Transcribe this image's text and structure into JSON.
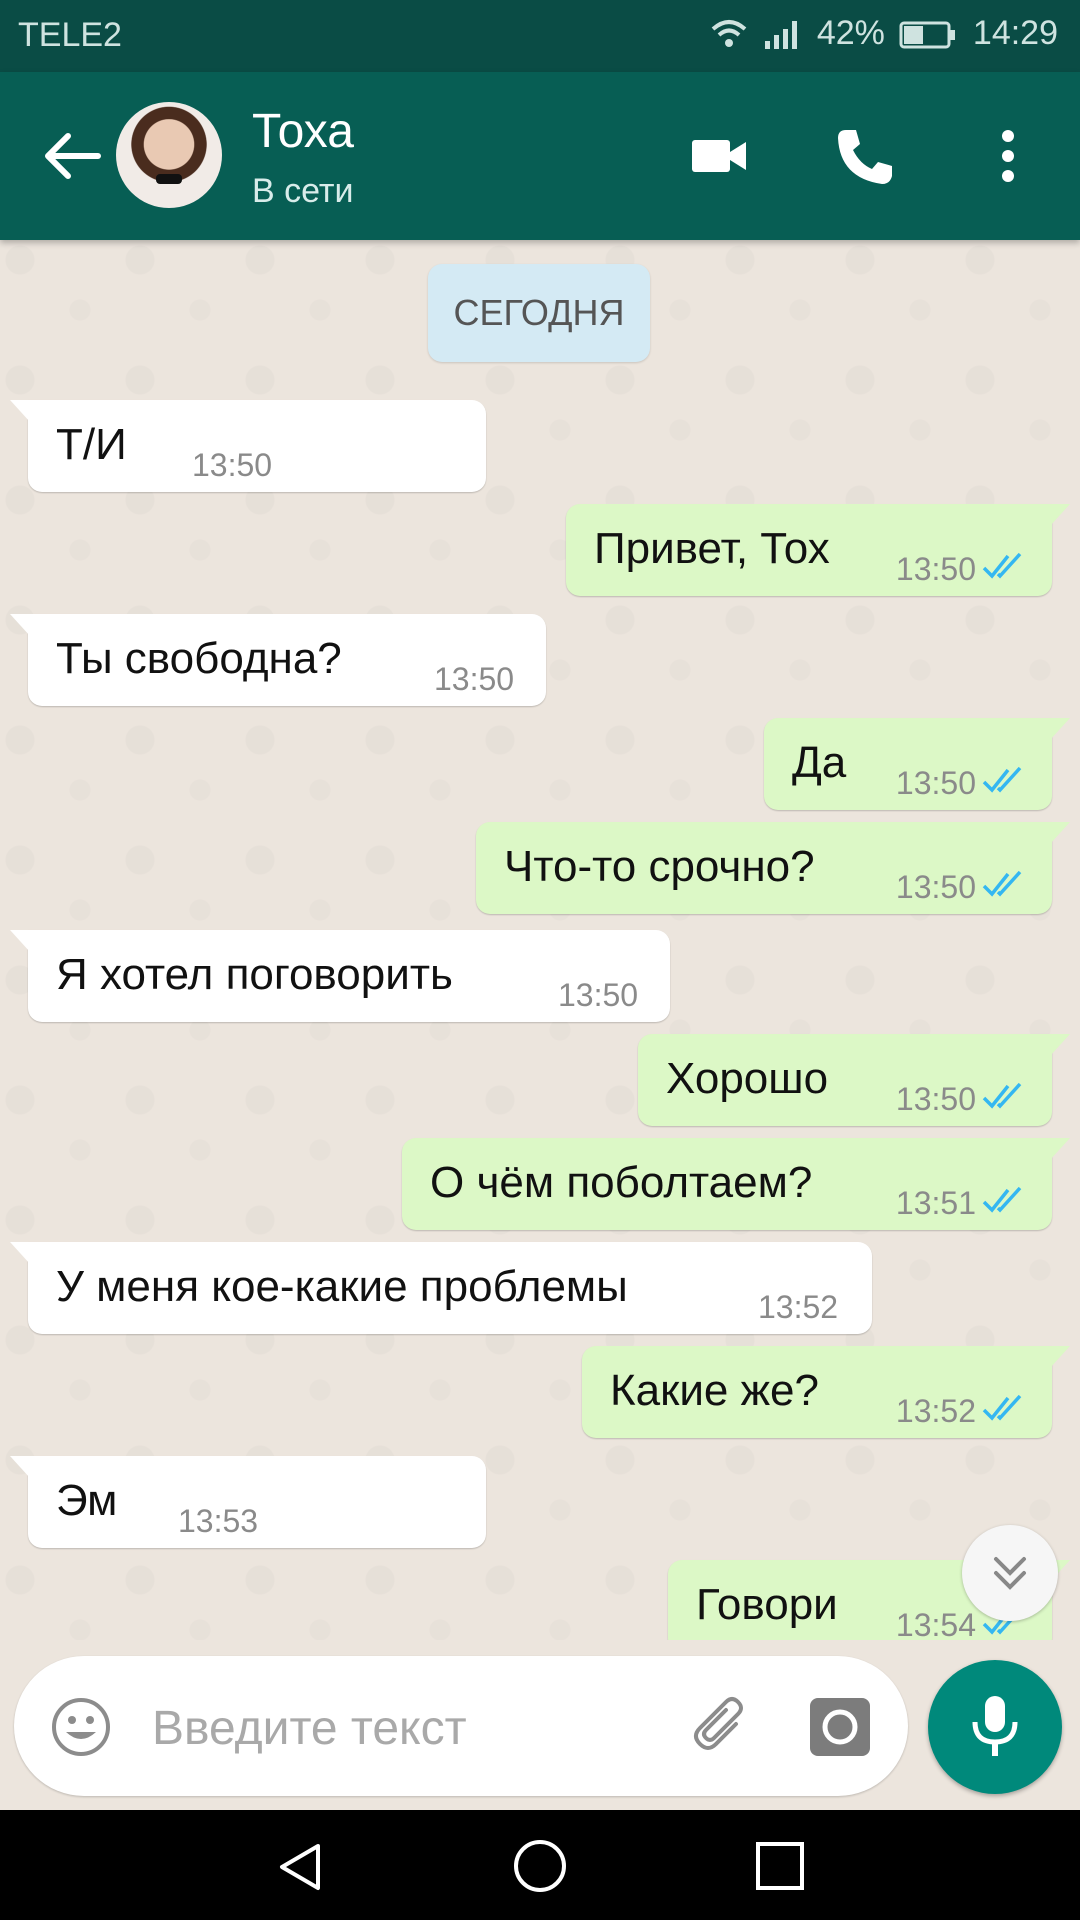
{
  "status_bar": {
    "carrier": "TELE2",
    "battery": "42%",
    "time": "14:29"
  },
  "header": {
    "name": "Тоха",
    "status": "В сети"
  },
  "date_chip": "СЕГОДНЯ",
  "messages": [
    {
      "dir": "in",
      "text": "Т/И",
      "time": "13:50"
    },
    {
      "dir": "out",
      "text": "Привет, Тох",
      "time": "13:50"
    },
    {
      "dir": "in",
      "text": "Ты свободна?",
      "time": "13:50"
    },
    {
      "dir": "out",
      "text": "Да",
      "time": "13:50"
    },
    {
      "dir": "out",
      "text": "Что-то срочно?",
      "time": "13:50"
    },
    {
      "dir": "in",
      "text": "Я хотел поговорить",
      "time": "13:50"
    },
    {
      "dir": "out",
      "text": "Хорошо",
      "time": "13:50"
    },
    {
      "dir": "out",
      "text": "О чём поболтаем?",
      "time": "13:51"
    },
    {
      "dir": "in",
      "text": "У меня кое-какие проблемы",
      "time": "13:52"
    },
    {
      "dir": "out",
      "text": "Какие же?",
      "time": "13:52"
    },
    {
      "dir": "in",
      "text": "Эм",
      "time": "13:53"
    },
    {
      "dir": "out",
      "text": "Говори",
      "time": "13:54"
    }
  ],
  "composer": {
    "placeholder": "Введите текст"
  },
  "colors": {
    "header": "#075e54",
    "status_bar": "#0a4c45",
    "outgoing": "#dcf8c6",
    "incoming": "#ffffff",
    "ticks": "#34b7f1",
    "mic": "#00897b"
  }
}
